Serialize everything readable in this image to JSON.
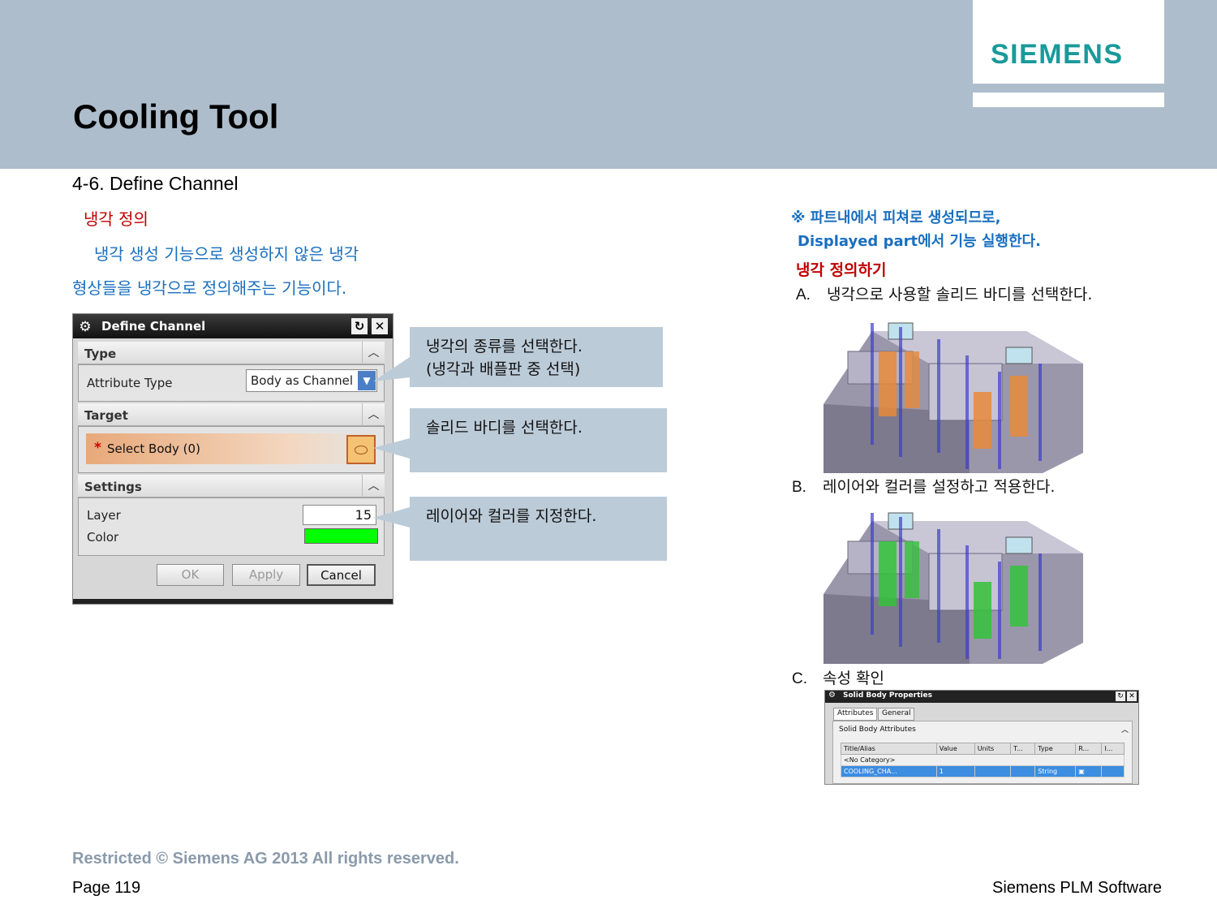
{
  "header": {
    "brand": "SIEMENS",
    "title": "Cooling Tool"
  },
  "section": {
    "title": "4-6. Define Channel",
    "heading": "냉각 정의",
    "desc_line1": "냉각 생성 기능으로 생성하지 않은 냉각",
    "desc_line2": "형상들을 냉각으로 정의해주는 기능이다."
  },
  "dialog": {
    "title": "Define Channel",
    "type_section": "Type",
    "attribute_type_label": "Attribute Type",
    "attribute_type_value": "Body as Channel",
    "target_section": "Target",
    "select_body_star": "*",
    "select_body_label": "Select Body (0)",
    "settings_section": "Settings",
    "layer_label": "Layer",
    "layer_value": "15",
    "color_label": "Color",
    "color_value": "#00ff00",
    "ok_label": "OK",
    "apply_label": "Apply",
    "cancel_label": "Cancel"
  },
  "callouts": {
    "type_line1": "냉각의 종류를 선택한다.",
    "type_line2": "(냉각과 배플판 중 선택)",
    "target": "솔리드 바디를 선택한다.",
    "settings": "레이어와 컬러를 지정한다."
  },
  "right": {
    "note_line1": "※ 파트내에서 피쳐로 생성되므로,",
    "note_line2": "Displayed part에서 기능 실행한다.",
    "howto_title": "냉각 정의하기",
    "step_a_letter": "A.",
    "step_a_text": "냉각으로 사용할 솔리드 바디를 선택한다.",
    "step_b_letter": "B.",
    "step_b_text": "레이어와 컬러를 설정하고 적용한다.",
    "step_c_letter": "C.",
    "step_c_text": "속성 확인"
  },
  "properties": {
    "title": "Solid Body Properties",
    "tab_attributes": "Attributes",
    "tab_general": "General",
    "section": "Solid Body Attributes",
    "columns": [
      "Title/Alias",
      "Value",
      "Units",
      "T...",
      "Type",
      "R...",
      "I..."
    ],
    "category": "<No Category>",
    "row_title": "COOLING_CHA...",
    "row_value": "1",
    "row_type": "String"
  },
  "footer": {
    "copyright": "Restricted © Siemens AG 2013 All rights reserved.",
    "page": "Page 119",
    "brand": "Siemens PLM Software"
  },
  "colors": {
    "header_bg": "#aebdcb",
    "brand": "#199a9a",
    "accent_red": "#c00000",
    "accent_blue": "#1a6fbf",
    "callout_bg": "#bccbd8",
    "channel_orange": "#e8893a",
    "channel_green": "#33c23a"
  }
}
